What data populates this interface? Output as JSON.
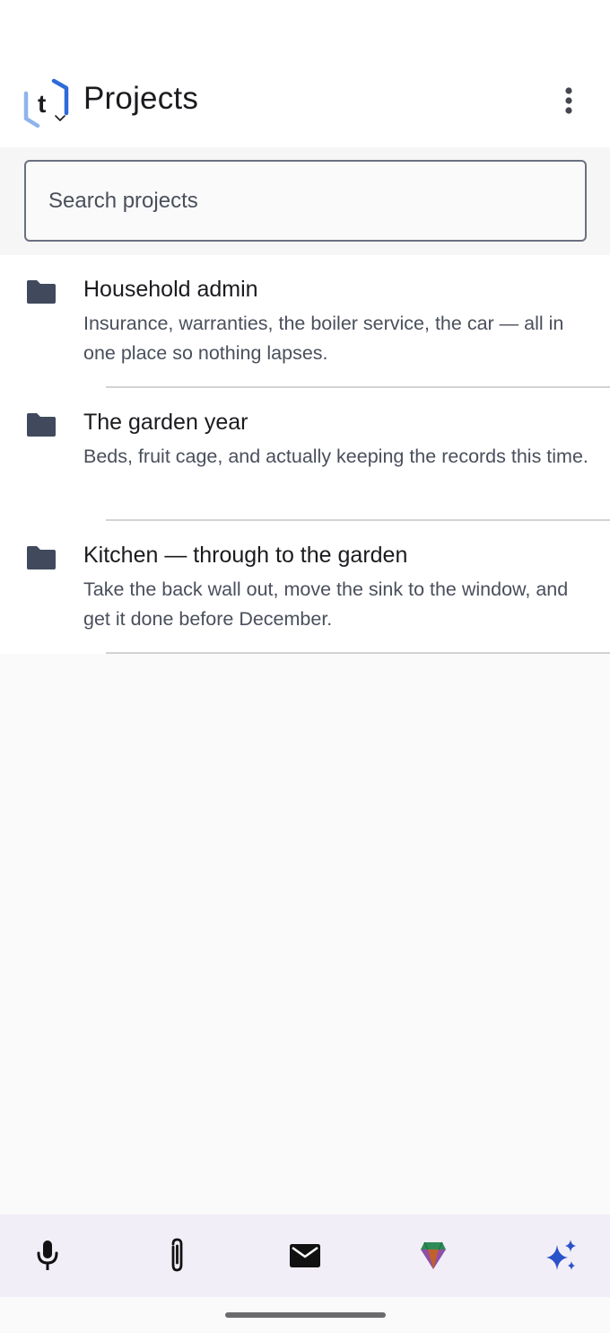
{
  "header": {
    "title": "Projects",
    "logo_letter": "t"
  },
  "search": {
    "placeholder": "Search projects",
    "value": ""
  },
  "projects": [
    {
      "title": "Household admin",
      "description": "Insurance, warranties, the boiler service, the car — all in one place so nothing lapses."
    },
    {
      "title": "The garden year",
      "description": "Beds, fruit cage, and actually keeping the records this time."
    },
    {
      "title": "Kitchen — through to the garden",
      "description": "Take the back wall out, move the sink to the window, and get it done before December."
    }
  ],
  "icons": {
    "logo": "app-logo-hexagon-t",
    "more": "more-vert-icon",
    "folder": "folder-icon",
    "bottom_bar": [
      "microphone-icon",
      "paperclip-icon",
      "mail-icon",
      "gem-icon",
      "sparkle-icon"
    ]
  },
  "colors": {
    "logo_blue": "#2f6bd8",
    "logo_light_blue": "#8fb3ee",
    "folder": "#404a5c",
    "sparkle": "#2a52c9",
    "bottom_bar_bg": "#f2eef8"
  }
}
